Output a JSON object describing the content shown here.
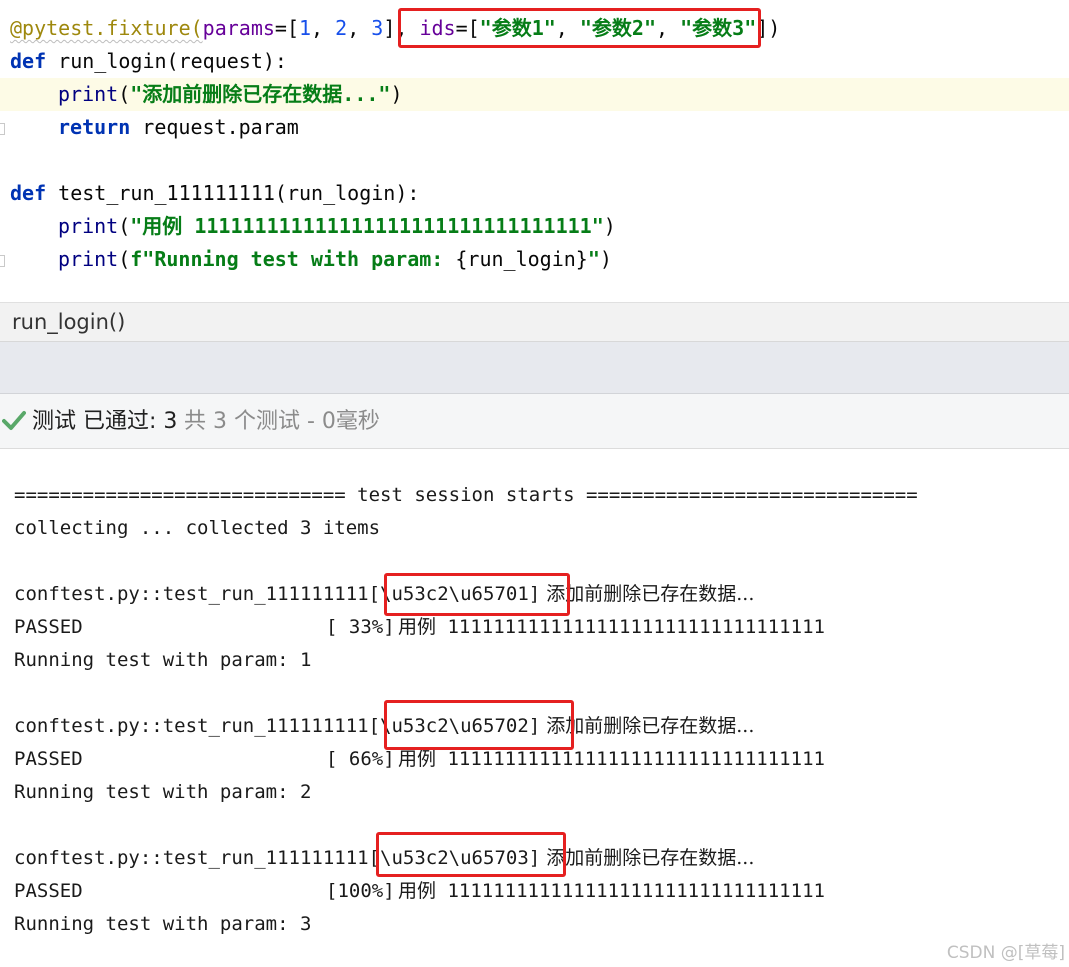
{
  "editor": {
    "line1": {
      "decorator": "@pytest.fixture(",
      "kwarg1": "params",
      "eq1": "=[",
      "n1": "1",
      "c1": ", ",
      "n2": "2",
      "c2": ", ",
      "n3": "3",
      "close1": "], ",
      "kwarg2": "ids",
      "eq2": "=[",
      "s1": "\"参数1\"",
      "c3": ", ",
      "s2": "\"参数2\"",
      "c4": ", ",
      "s3": "\"参数3\"",
      "close2": "])"
    },
    "line2": {
      "kw": "def",
      "rest": " run_login(request):"
    },
    "line3": {
      "fn": "print",
      "open": "(",
      "str": "\"添加前删除已存在数据...\"",
      "close": ")"
    },
    "line4": {
      "kw": "return",
      "rest": " request.param"
    },
    "line6": {
      "kw": "def",
      "rest": " test_run_111111111(run_login):"
    },
    "line7": {
      "fn": "print",
      "open": "(",
      "str": "\"用例 111111111111111111111111111111111\"",
      "close": ")"
    },
    "line8": {
      "fn": "print",
      "open": "(",
      "str_a": "f\"Running test with param: ",
      "brace_open": "{",
      "var": "run_login",
      "brace_close": "}",
      "str_b": "\"",
      "close": ")"
    }
  },
  "breadcrumb": {
    "text": "run_login()"
  },
  "status": {
    "passed_label": "测试 已通过: 3",
    "summary": "共 3 个测试 - 0毫秒",
    "check_color": "#59a869"
  },
  "console": {
    "session_line": "============================= test session starts =============================",
    "collecting_line": "collecting ... collected 3 items",
    "tests": [
      {
        "prefix": "conftest.py::test_run_111111111",
        "id": "[\\u53c2\\u65701]",
        "msg": " 添加前删除已存在数据...",
        "passed": "PASSED",
        "pct": "[ 33%]",
        "out1": "用例",
        "out2": " 111111111111111111111111111111111",
        "param_line": "Running test with param: 1"
      },
      {
        "prefix": "conftest.py::test_run_111111111",
        "id": "[\\u53c2\\u65702]",
        "msg": " 添加前删除已存在数据...",
        "passed": "PASSED",
        "pct": "[ 66%]",
        "out1": "用例",
        "out2": " 111111111111111111111111111111111",
        "param_line": "Running test with param: 2"
      },
      {
        "prefix": "conftest.py::test_run_111111111",
        "id": "[\\u53c2\\u65703]",
        "msg": " 添加前删除已存在数据...",
        "passed": "PASSED",
        "pct": "[100%]",
        "out1": "用例",
        "out2": " 111111111111111111111111111111111",
        "param_line": "Running test with param: 3"
      }
    ]
  },
  "watermark": "CSDN @[草莓]",
  "colors": {
    "highlight_box": "#e52020",
    "keyword": "#0033b3",
    "string": "#067d17",
    "number": "#1750eb",
    "decorator": "#9e880d"
  }
}
